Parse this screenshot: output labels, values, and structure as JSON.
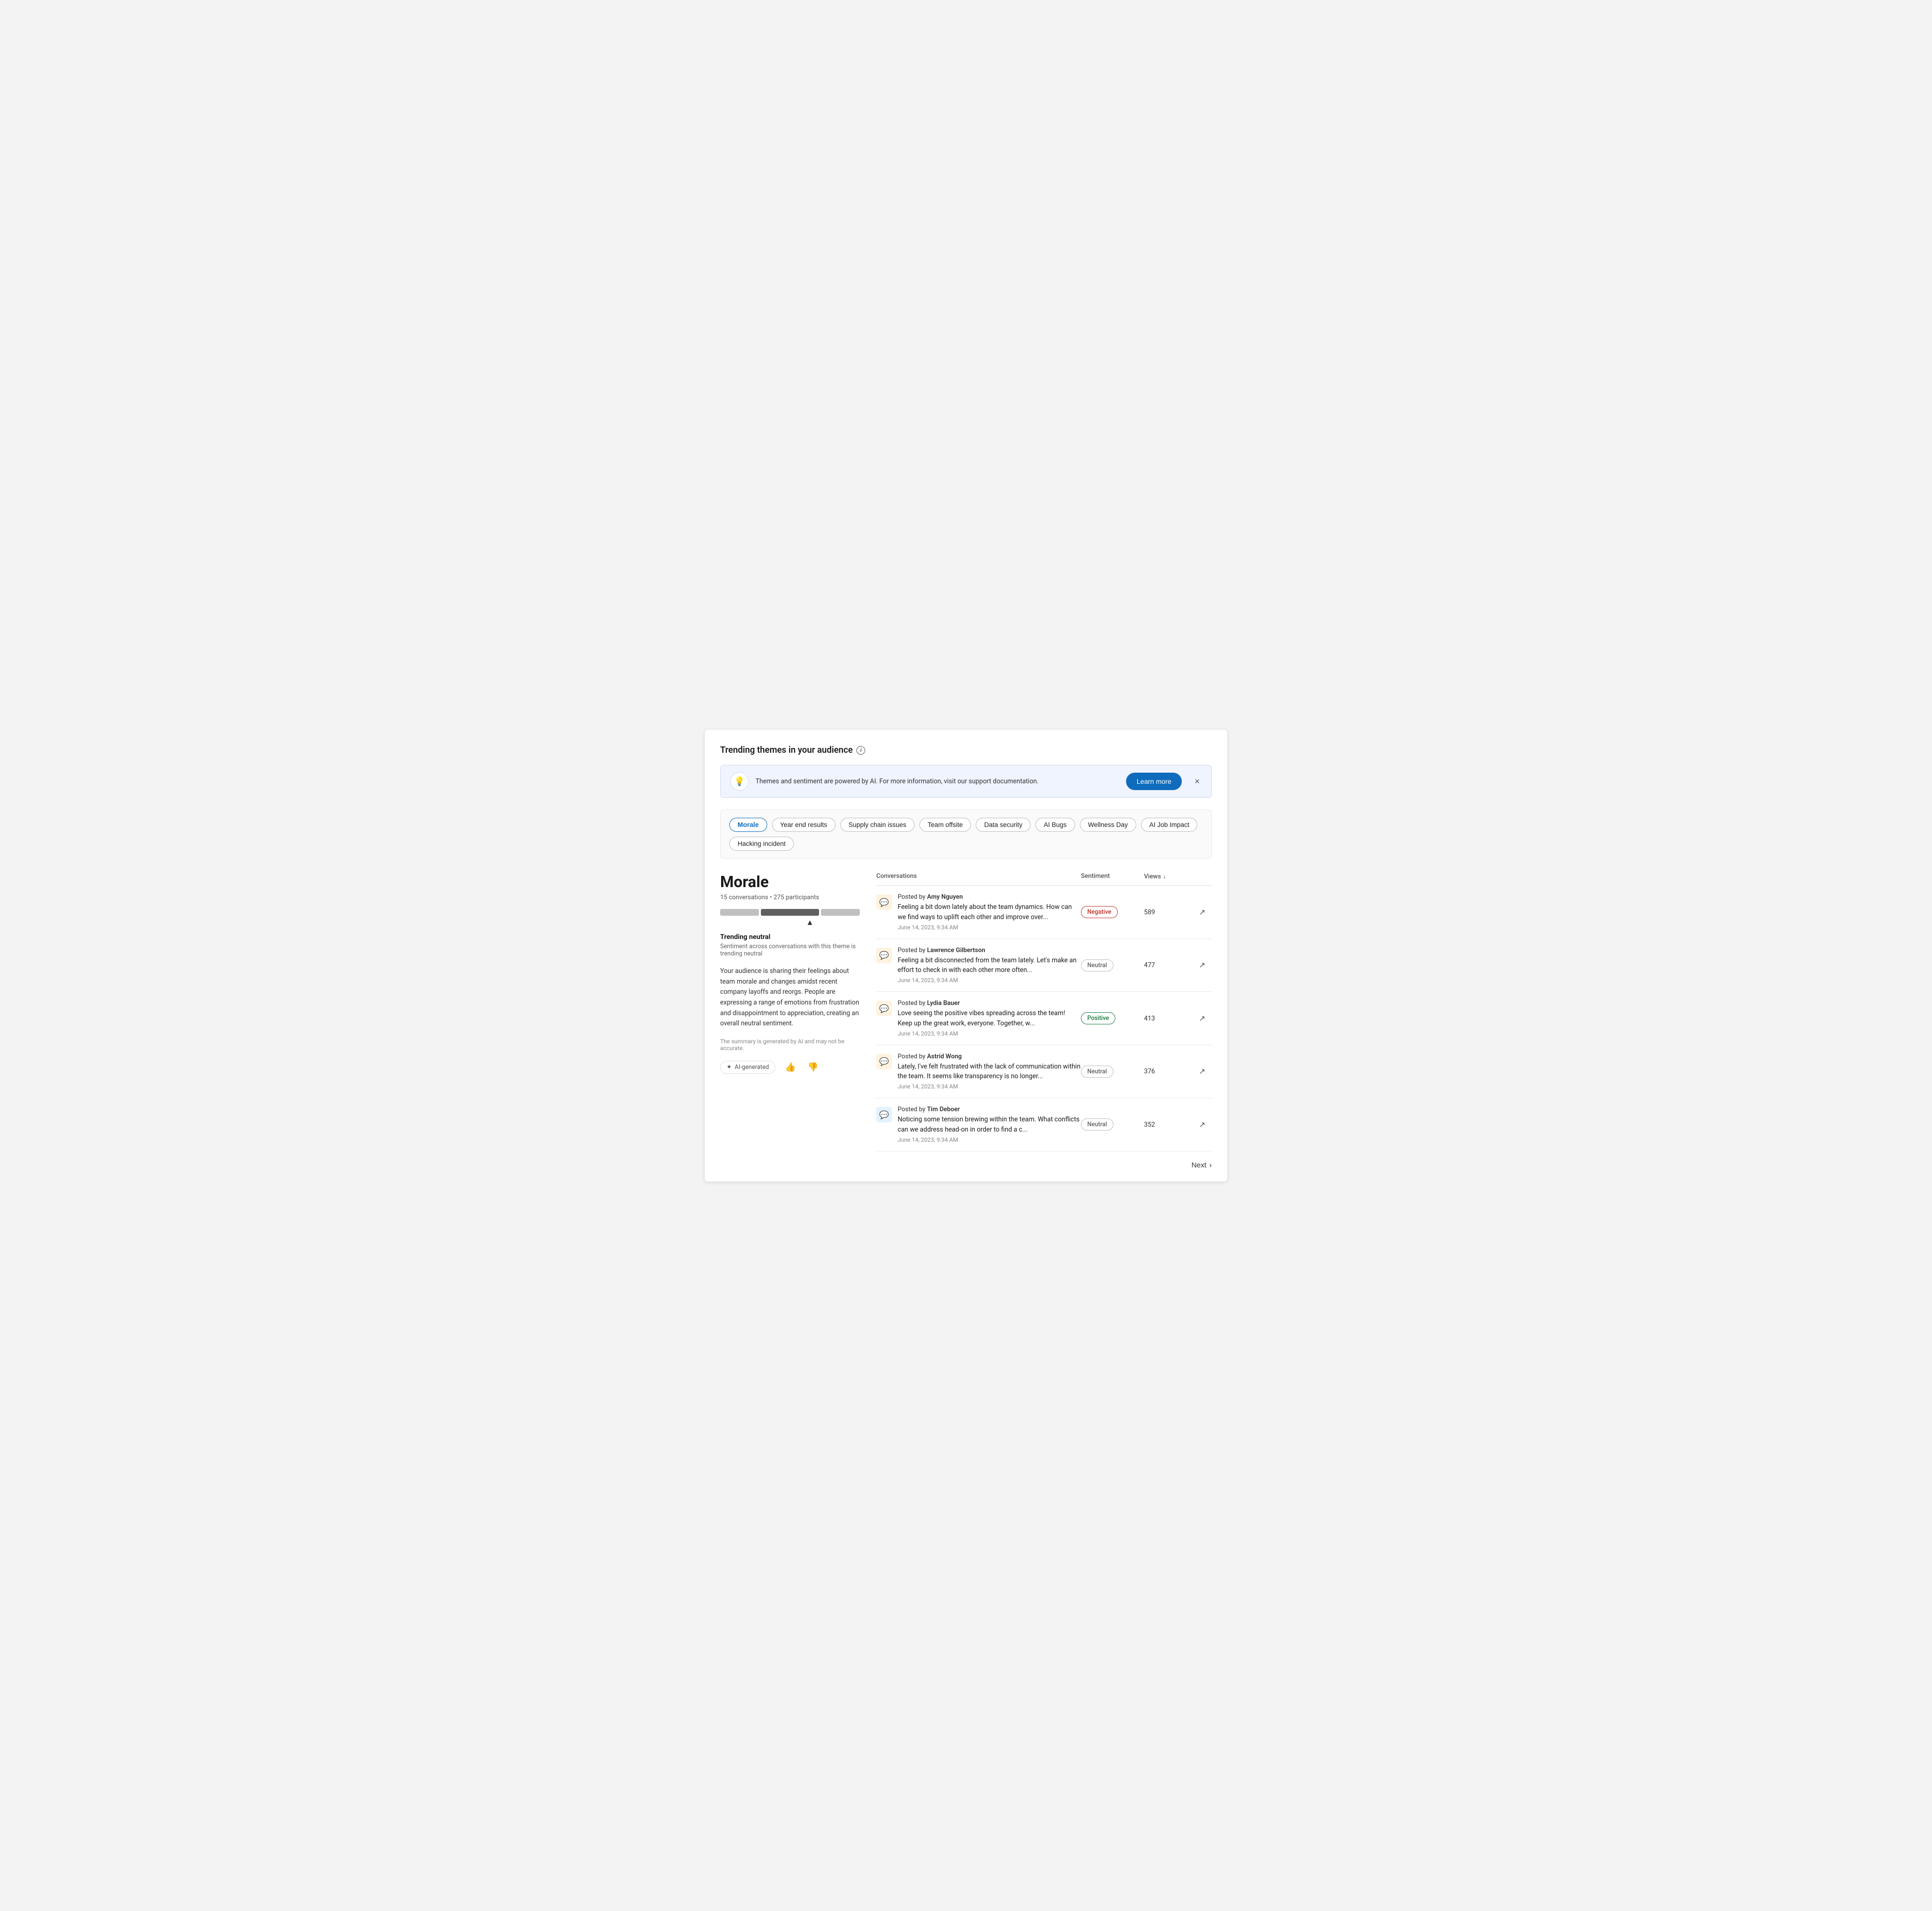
{
  "page": {
    "title": "Trending themes in your audience"
  },
  "banner": {
    "text": "Themes and sentiment are powered by AI. For more information, visit our support documentation.",
    "learn_more_label": "Learn more",
    "close_label": "×"
  },
  "tags": [
    {
      "id": "morale",
      "label": "Morale",
      "active": true
    },
    {
      "id": "year-end",
      "label": "Year end results",
      "active": false
    },
    {
      "id": "supply-chain",
      "label": "Supply chain issues",
      "active": false
    },
    {
      "id": "team-offsite",
      "label": "Team offsite",
      "active": false
    },
    {
      "id": "data-security",
      "label": "Data security",
      "active": false
    },
    {
      "id": "ai-bugs",
      "label": "AI Bugs",
      "active": false
    },
    {
      "id": "wellness-day",
      "label": "Wellness Day",
      "active": false
    },
    {
      "id": "ai-job-impact",
      "label": "AI Job Impact",
      "active": false
    },
    {
      "id": "hacking-incident",
      "label": "Hacking incident",
      "active": false
    }
  ],
  "theme": {
    "title": "Morale",
    "conversations_count": "15 conversations",
    "participants_count": "275 participants",
    "trending_label": "Trending neutral",
    "trending_sub": "Sentiment across conversations with this theme is trending neutral",
    "description": "Your audience is sharing their feelings about team morale and changes amidst recent company layoffs and reorgs. People are expressing a range of emotions from frustration and disappointment to appreciation, creating an overall neutral sentiment.",
    "disclaimer": "The summary is generated by AI and may not be accurate.",
    "ai_badge": "AI-generated",
    "thumbup_label": "👍",
    "thumbdown_label": "👎"
  },
  "table": {
    "col_conversations": "Conversations",
    "col_sentiment": "Sentiment",
    "col_views": "Views",
    "sort_arrow": "↓",
    "rows": [
      {
        "author": "Amy Nguyen",
        "text": "Feeling a bit down lately about the team dynamics. How can we find ways to uplift each other and improve over...",
        "date": "June 14, 2023, 9:34 AM",
        "sentiment": "Negative",
        "sentiment_class": "negative",
        "views": "589",
        "icon_type": "orange"
      },
      {
        "author": "Lawrence Gilbertson",
        "text": "Feeling a bit disconnected from the team lately. Let's make an effort to check in with each other more often...",
        "date": "June 14, 2023, 9:34 AM",
        "sentiment": "Neutral",
        "sentiment_class": "neutral",
        "views": "477",
        "icon_type": "orange"
      },
      {
        "author": "Lydia Bauer",
        "text": "Love seeing the positive vibes spreading across the team! Keep up the great work, everyone. Together, w...",
        "date": "June 14, 2023, 9:34 AM",
        "sentiment": "Positive",
        "sentiment_class": "positive",
        "views": "413",
        "icon_type": "orange"
      },
      {
        "author": "Astrid Wong",
        "text": "Lately, I've felt frustrated with the lack of communication within the team. It seems like transparency is no longer...",
        "date": "June 14, 2023, 9:34 AM",
        "sentiment": "Neutral",
        "sentiment_class": "neutral",
        "views": "376",
        "icon_type": "orange"
      },
      {
        "author": "Tim Deboer",
        "text": "Noticing some tension brewing within the team. What conflicts can we address head-on in order to find a c...",
        "date": "June 14, 2023, 9:34 AM",
        "sentiment": "Neutral",
        "sentiment_class": "neutral",
        "views": "352",
        "icon_type": "blue"
      }
    ]
  },
  "pagination": {
    "next_label": "Next"
  }
}
